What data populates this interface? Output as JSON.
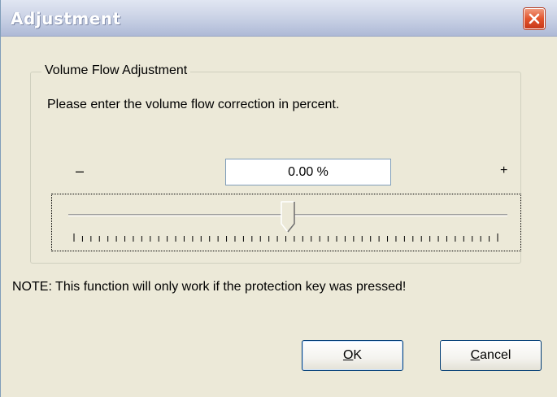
{
  "window": {
    "title": "Adjustment",
    "close_icon": "close-icon"
  },
  "group": {
    "legend": "Volume Flow Adjustment",
    "instruction": "Please enter the volume flow correction in percent."
  },
  "adjuster": {
    "minus_label": "–",
    "plus_label": "+",
    "value": "0.00 %",
    "slider_position_fraction": 0.5
  },
  "note": "NOTE: This function will only work if the protection key was pressed!",
  "buttons": {
    "ok": {
      "mnemonic": "O",
      "rest": "K"
    },
    "cancel": {
      "mnemonic": "C",
      "rest": "ancel"
    }
  },
  "colors": {
    "dialog_background": "#ece9d8",
    "close_button": "#e2542c",
    "button_border": "#003c74"
  }
}
